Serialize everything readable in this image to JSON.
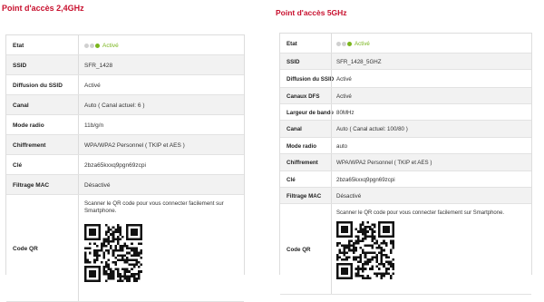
{
  "colors": {
    "accent": "#c8102e",
    "status_on": "#7ab51d",
    "status_off": "#d0d0d0"
  },
  "left": {
    "title": "Point d'accès 2,4GHz",
    "rows": [
      {
        "label": "Etat",
        "value": "Activé",
        "type": "status"
      },
      {
        "label": "SSID",
        "value": "SFR_1428"
      },
      {
        "label": "Diffusion du SSID",
        "value": "Activé"
      },
      {
        "label": "Canal",
        "value": "Auto ( Canal actuel: 6 )"
      },
      {
        "label": "Mode radio",
        "value": "11b/g/n"
      },
      {
        "label": "Chiffrement",
        "value": "WPA/WPA2 Personnel ( TKIP et AES )"
      },
      {
        "label": "Clé",
        "value": "2bza65kxxq9pgn69zcpi"
      },
      {
        "label": "Filtrage MAC",
        "value": "Désactivé"
      },
      {
        "label": "Code QR",
        "value": "Scanner le QR code pour vous connecter facilement sur Smartphone.",
        "type": "qr"
      }
    ]
  },
  "right": {
    "title": "Point d'accès 5GHz",
    "rows": [
      {
        "label": "Etat",
        "value": "Activé",
        "type": "status"
      },
      {
        "label": "SSID",
        "value": "SFR_1428_5GHZ"
      },
      {
        "label": "Diffusion du SSID",
        "value": "Activé"
      },
      {
        "label": "Canaux DFS",
        "value": "Activé"
      },
      {
        "label": "Largeur de bande",
        "value": "80MHz"
      },
      {
        "label": "Canal",
        "value": "Auto ( Canal actuel: 100/80 )"
      },
      {
        "label": "Mode radio",
        "value": "auto"
      },
      {
        "label": "Chiffrement",
        "value": "WPA/WPA2 Personnel ( TKIP et AES )"
      },
      {
        "label": "Clé",
        "value": "2bza65kxxq9pgn69zcpi"
      },
      {
        "label": "Filtrage MAC",
        "value": "Désactivé"
      },
      {
        "label": "Code QR",
        "value": "Scanner le QR code pour vous connecter facilement sur Smartphone.",
        "type": "qr"
      }
    ]
  }
}
